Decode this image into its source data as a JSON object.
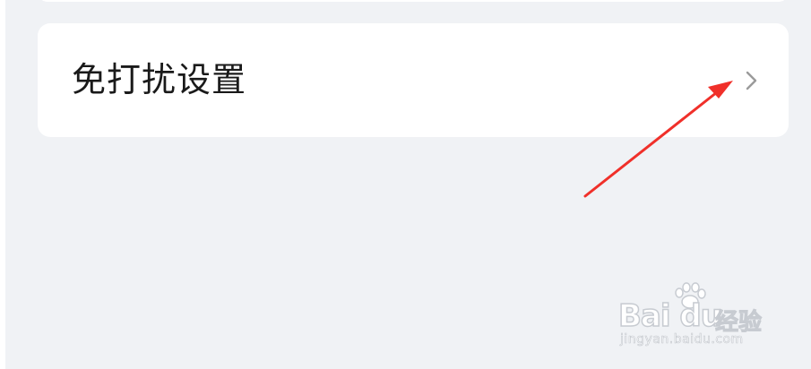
{
  "settings": {
    "dnd_row": {
      "label": "免打扰设置",
      "chevron_icon": "chevron-right-icon"
    }
  },
  "annotation": {
    "arrow_color": "#f0302a"
  },
  "watermark": {
    "brand": "Bai du",
    "brand_cn": "经验",
    "url": "jingyan.baidu.com"
  },
  "colors": {
    "background": "#f0f2f5",
    "card": "#ffffff",
    "text": "#1a1a1a",
    "chevron": "#9a9a9a"
  }
}
